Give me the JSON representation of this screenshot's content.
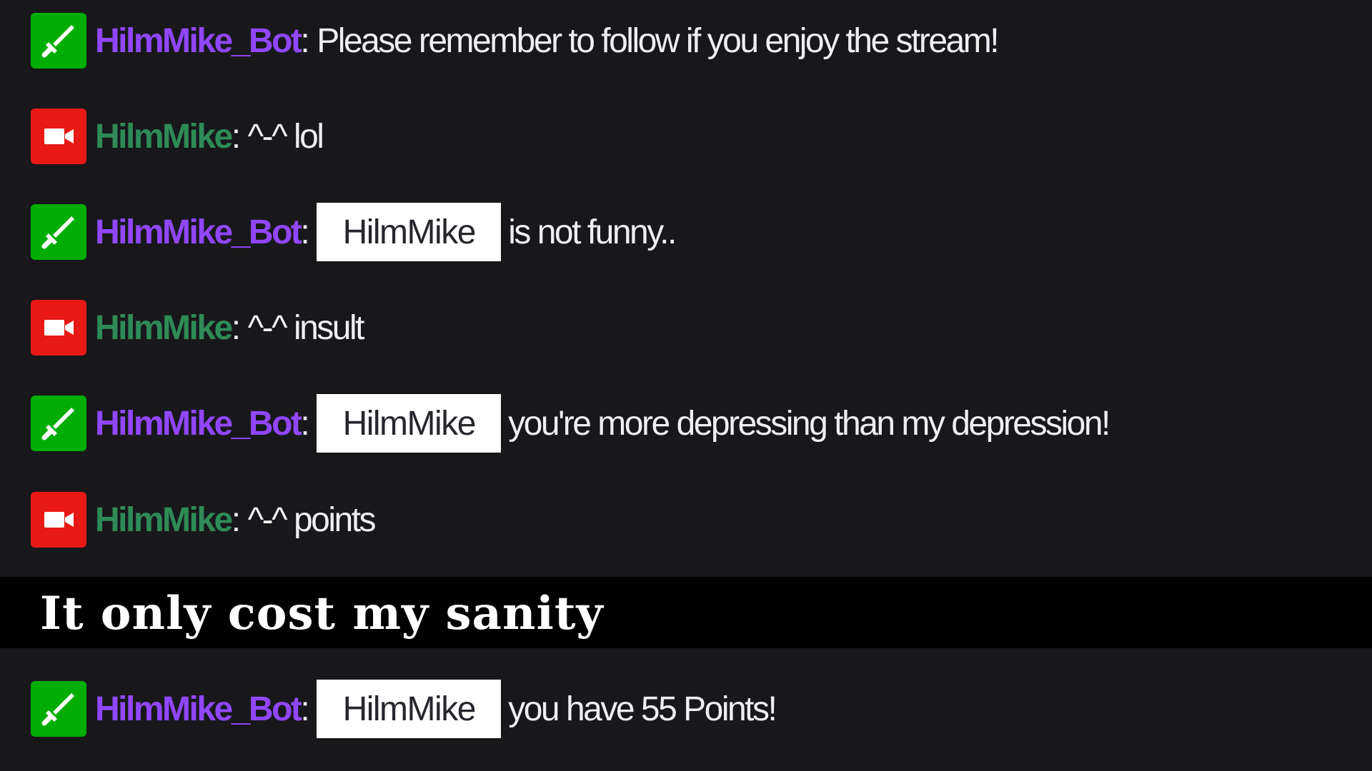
{
  "chat": {
    "messages": [
      {
        "badge": "moderator-sword-icon",
        "username": "HilmMike_Bot",
        "separator": ":",
        "mention": "",
        "text": "Please remember to follow if you enjoy the stream!"
      },
      {
        "badge": "broadcaster-camera-icon",
        "username": "HilmMike",
        "separator": ":",
        "mention": "",
        "text": "^-^ lol"
      },
      {
        "badge": "moderator-sword-icon",
        "username": "HilmMike_Bot",
        "separator": ":",
        "mention": "HilmMike",
        "text": "is not funny.."
      },
      {
        "badge": "broadcaster-camera-icon",
        "username": "HilmMike",
        "separator": ":",
        "mention": "",
        "text": "^-^ insult"
      },
      {
        "badge": "moderator-sword-icon",
        "username": "HilmMike_Bot",
        "separator": ":",
        "mention": "HilmMike",
        "text": "you're more depressing than my depression!"
      },
      {
        "badge": "broadcaster-camera-icon",
        "username": "HilmMike",
        "separator": ":",
        "mention": "",
        "text": "^-^ points"
      },
      {
        "badge": "moderator-sword-icon",
        "username": "HilmMike_Bot",
        "separator": ":",
        "mention": "HilmMike",
        "text": "you have 55 Points!"
      }
    ]
  },
  "caption": {
    "text": "It only cost my sanity"
  },
  "colors": {
    "background": "#18181b",
    "bot_name": "#9147ff",
    "streamer_name": "#2e8b57",
    "moderator_badge": "#00ad03",
    "broadcaster_badge": "#e91916",
    "mention_highlight": "#ffffff",
    "message_text": "#efeff1"
  }
}
